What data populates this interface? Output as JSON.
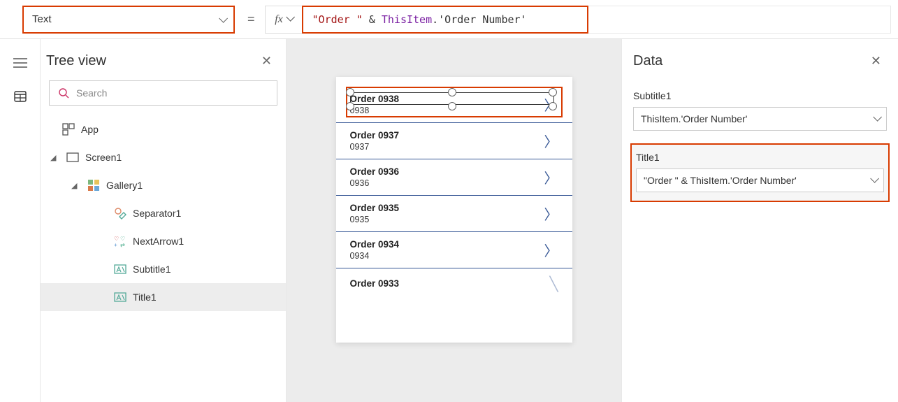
{
  "formulaBar": {
    "property": "Text",
    "equals": "=",
    "fx": "fx",
    "formula": {
      "str": "\"Order \"",
      "amp": " & ",
      "obj": "ThisItem",
      "dot": ".",
      "field": "'Order Number'"
    }
  },
  "treeView": {
    "title": "Tree view",
    "searchPlaceholder": "Search",
    "items": {
      "app": "App",
      "screen": "Screen1",
      "gallery": "Gallery1",
      "separator": "Separator1",
      "nextArrow": "NextArrow1",
      "subtitle": "Subtitle1",
      "title": "Title1"
    }
  },
  "gallery": [
    {
      "title": "Order 0938",
      "sub": "0938"
    },
    {
      "title": "Order 0937",
      "sub": "0937"
    },
    {
      "title": "Order 0936",
      "sub": "0936"
    },
    {
      "title": "Order 0935",
      "sub": "0935"
    },
    {
      "title": "Order 0934",
      "sub": "0934"
    },
    {
      "title": "Order 0933",
      "sub": ""
    }
  ],
  "dataPanel": {
    "title": "Data",
    "subtitle": {
      "label": "Subtitle1",
      "value": "ThisItem.'Order Number'"
    },
    "titleField": {
      "label": "Title1",
      "value": "\"Order \" & ThisItem.'Order Number'"
    }
  }
}
